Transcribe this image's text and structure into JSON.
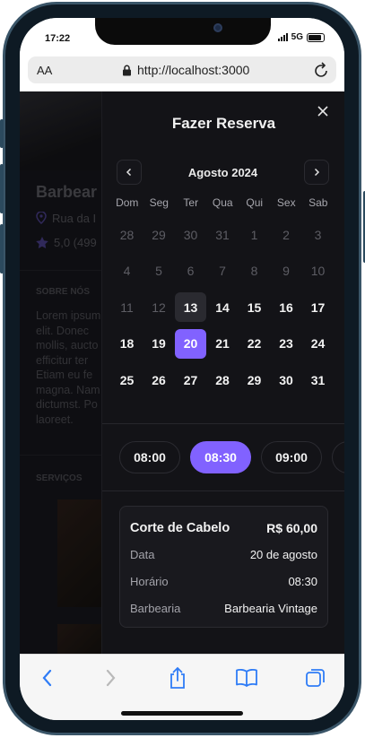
{
  "status": {
    "time": "17:22",
    "network": "5G"
  },
  "browser": {
    "aa_label": "AA",
    "url": "http://localhost:3000"
  },
  "background_page": {
    "title": "Barbear",
    "address": "Rua da I",
    "rating": "5,0 (499",
    "about_heading": "SOBRE NÓS",
    "about_text": "Lorem ipsum elit. Donec mollis, aucto efficitur ter Etiam eu fe magna. Nam dictumst. Po laoreet.",
    "services_heading": "SERVIÇOS"
  },
  "booking": {
    "title": "Fazer Reserva",
    "month": "Agosto 2024",
    "weekdays": [
      "Dom",
      "Seg",
      "Ter",
      "Qua",
      "Qui",
      "Sex",
      "Sab"
    ],
    "weeks": [
      [
        "28",
        "29",
        "30",
        "31",
        "1",
        "2",
        "3"
      ],
      [
        "4",
        "5",
        "6",
        "7",
        "8",
        "9",
        "10"
      ],
      [
        "11",
        "12",
        "13",
        "14",
        "15",
        "16",
        "17"
      ],
      [
        "18",
        "19",
        "20",
        "21",
        "22",
        "23",
        "24"
      ],
      [
        "25",
        "26",
        "27",
        "28",
        "29",
        "30",
        "31"
      ]
    ],
    "today": "13",
    "selected_day": "20",
    "times": [
      "08:00",
      "08:30",
      "09:00"
    ],
    "selected_time": "08:30",
    "summary": {
      "service": "Corte de Cabelo",
      "price": "R$ 60,00",
      "date_label": "Data",
      "date_value": "20 de agosto",
      "time_label": "Horário",
      "time_value": "08:30",
      "shop_label": "Barbearia",
      "shop_value": "Barbearia Vintage"
    }
  },
  "colors": {
    "accent": "#8162ff",
    "sheet_bg": "#131317",
    "toolbar_icon": "#2f7cf6"
  },
  "icons": [
    "lock-icon",
    "reload-icon",
    "close-icon",
    "chevron-left-icon",
    "chevron-right-icon",
    "share-icon",
    "book-icon",
    "tabs-icon",
    "map-pin-icon",
    "star-icon"
  ]
}
